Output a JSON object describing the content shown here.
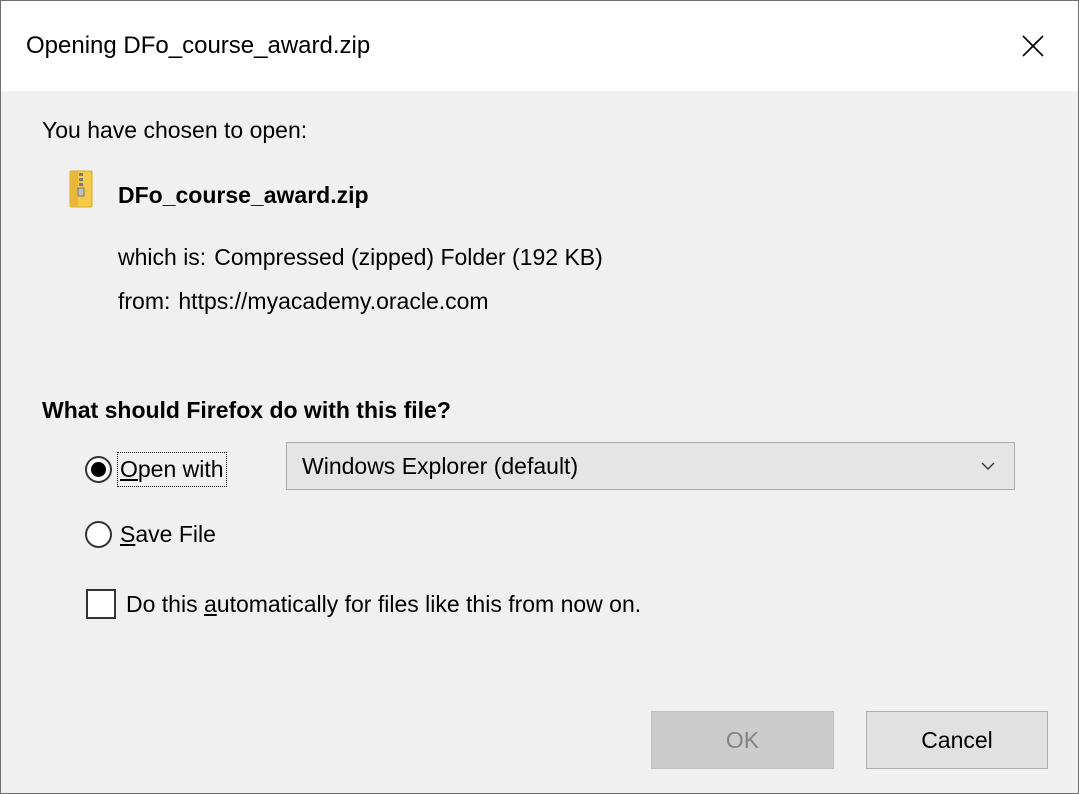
{
  "window": {
    "title": "Opening DFo_course_award.zip",
    "close_icon": "close-icon"
  },
  "dialog": {
    "prompt": "You have chosen to open:",
    "file": {
      "icon": "zip-folder-icon",
      "name": "DFo_course_award.zip",
      "which_label": "which is:",
      "which_value": "Compressed (zipped) Folder (192 KB)",
      "from_label": "from:",
      "from_value": "https://myacademy.oracle.com"
    },
    "question": "What should Firefox do with this file?",
    "open_with": {
      "label_access": "O",
      "label_rest": "pen with",
      "selected": true,
      "application": "Windows Explorer (default)"
    },
    "save_file": {
      "label_access": "S",
      "label_rest": "ave File",
      "selected": false
    },
    "auto_checkbox": {
      "label_pre": "Do this ",
      "label_access": "a",
      "label_post": "utomatically for files like this from now on.",
      "checked": false
    },
    "buttons": {
      "ok": "OK",
      "cancel": "Cancel"
    }
  },
  "colors": {
    "titlebar_bg": "#ffffff",
    "body_bg": "#f0f0f0",
    "button_bg": "#e1e1e1",
    "disabled_text": "#838383"
  }
}
